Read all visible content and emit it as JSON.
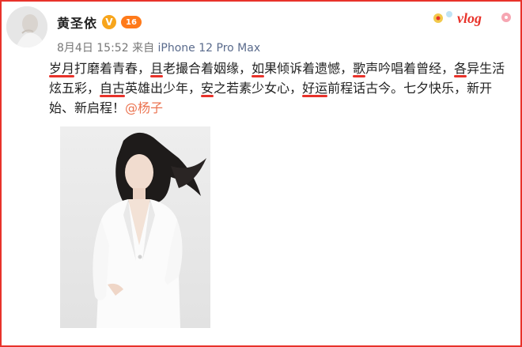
{
  "user": {
    "name": "黄圣依",
    "verified_badge": "V",
    "level_badge": "16"
  },
  "meta": {
    "date": "8月4日 15:52",
    "source_prefix": "来自",
    "device": "iPhone 12 Pro Max"
  },
  "sticker": {
    "text": "vlog"
  },
  "post": {
    "segments": [
      {
        "text": "岁月",
        "highlight": true
      },
      {
        "text": "打磨着青春，",
        "highlight": false
      },
      {
        "text": "且",
        "highlight": true
      },
      {
        "text": "老撮合着姻缘，",
        "highlight": false
      },
      {
        "text": "如",
        "highlight": true
      },
      {
        "text": "果倾诉着遗憾，",
        "highlight": false
      },
      {
        "text": "歌",
        "highlight": true
      },
      {
        "text": "声吟唱着曾经，",
        "highlight": false
      },
      {
        "text": "各",
        "highlight": true
      },
      {
        "text": "异生活炫五彩，",
        "highlight": false
      },
      {
        "text": "自古",
        "highlight": true
      },
      {
        "text": "英雄出少年，",
        "highlight": false
      },
      {
        "text": "安",
        "highlight": true
      },
      {
        "text": "之若素少女心，",
        "highlight": false
      },
      {
        "text": "好运",
        "highlight": true
      },
      {
        "text": "前程话古今。七夕快乐，新开始、新启程！",
        "highlight": false
      }
    ],
    "mention": "@杨子"
  },
  "colors": {
    "accent_red": "#e8322a",
    "mention": "#eb7350",
    "badge_v": "#f7a51c",
    "badge_level": "#ff7a1a"
  },
  "icons": [
    "avatar",
    "verified-badge-icon",
    "level-badge-icon",
    "vlog-sticker-icon"
  ]
}
